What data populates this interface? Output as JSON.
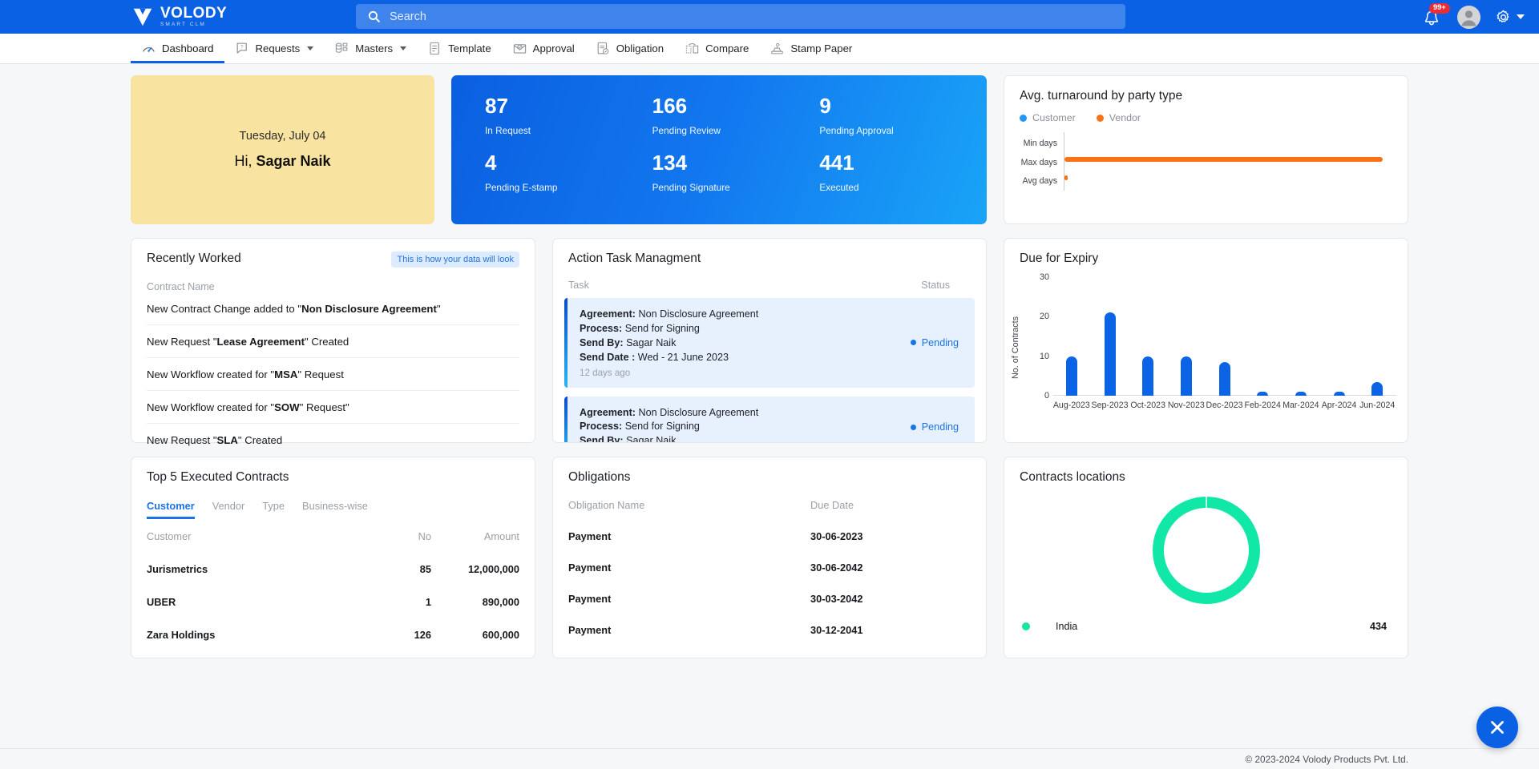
{
  "header": {
    "logo_text": "VOLODY",
    "logo_sub": "SMART CLM",
    "search_placeholder": "Search",
    "search_value": "",
    "notification_badge": "99+"
  },
  "nav": {
    "items": [
      {
        "label": "Dashboard",
        "icon": "speedometer-icon",
        "active": true,
        "caret": false
      },
      {
        "label": "Requests",
        "icon": "request-icon",
        "active": false,
        "caret": true
      },
      {
        "label": "Masters",
        "icon": "masters-icon",
        "active": false,
        "caret": true
      },
      {
        "label": "Template",
        "icon": "template-icon",
        "active": false,
        "caret": false
      },
      {
        "label": "Approval",
        "icon": "approval-icon",
        "active": false,
        "caret": false
      },
      {
        "label": "Obligation",
        "icon": "obligation-icon",
        "active": false,
        "caret": false
      },
      {
        "label": "Compare",
        "icon": "compare-icon",
        "active": false,
        "caret": false
      },
      {
        "label": "Stamp Paper",
        "icon": "stamp-icon",
        "active": false,
        "caret": false
      }
    ]
  },
  "greeting": {
    "date": "Tuesday, July 04",
    "hi_prefix": "Hi, ",
    "user_name": "Sagar Naik"
  },
  "stats": {
    "items": [
      {
        "value": "87",
        "label": "In Request"
      },
      {
        "value": "166",
        "label": "Pending Review"
      },
      {
        "value": "9",
        "label": "Pending Approval"
      },
      {
        "value": "4",
        "label": "Pending E-stamp"
      },
      {
        "value": "134",
        "label": "Pending Signature"
      },
      {
        "value": "441",
        "label": "Executed"
      }
    ]
  },
  "turnaround": {
    "title": "Avg. turnaround by party type",
    "legend": [
      {
        "label": "Customer",
        "color": "#2196f3"
      },
      {
        "label": "Vendor",
        "color": "#f97316"
      }
    ]
  },
  "recently_worked": {
    "title": "Recently Worked",
    "badge": "This is how your data will look",
    "column_header": "Contract Name",
    "items": [
      {
        "prefix": "New Contract Change added to \"",
        "strong": "Non Disclosure Agreement",
        "suffix": "\""
      },
      {
        "prefix": "New Request \"",
        "strong": "Lease Agreement",
        "suffix": "\" Created"
      },
      {
        "prefix": "New Workflow created for \"",
        "strong": "MSA",
        "suffix": "\" Request"
      },
      {
        "prefix": "New Workflow created for \"",
        "strong": "SOW",
        "suffix": "\" Request\""
      },
      {
        "prefix": "New Request \"",
        "strong": "SLA",
        "suffix": "\" Created"
      }
    ]
  },
  "action_tasks": {
    "title": "Action Task Managment",
    "col_task": "Task",
    "col_status": "Status",
    "items": [
      {
        "agreement_label": "Agreement:",
        "agreement_value": "Non Disclosure Agreement",
        "process_label": "Process:",
        "process_value": "Send for Signing",
        "sendby_label": "Send By:",
        "sendby_value": "Sagar Naik",
        "senddate_label": "Send Date :",
        "senddate_value": "Wed - 21 June 2023",
        "ago": "12 days ago",
        "status": "Pending"
      },
      {
        "agreement_label": "Agreement:",
        "agreement_value": "Non Disclosure Agreement",
        "process_label": "Process:",
        "process_value": "Send for Signing",
        "sendby_label": "Send By:",
        "sendby_value": "Sagar Naik",
        "senddate_label": "",
        "senddate_value": "",
        "ago": "",
        "status": "Pending"
      }
    ]
  },
  "due_expiry": {
    "title": "Due for Expiry"
  },
  "top5": {
    "title": "Top 5 Executed Contracts",
    "tabs": [
      {
        "label": "Customer",
        "active": true
      },
      {
        "label": "Vendor",
        "active": false
      },
      {
        "label": "Type",
        "active": false
      },
      {
        "label": "Business-wise",
        "active": false
      }
    ],
    "columns": [
      "Customer",
      "No",
      "Amount"
    ],
    "rows": [
      {
        "name": "Jurismetrics",
        "no": "85",
        "amount": "12,000,000"
      },
      {
        "name": "UBER",
        "no": "1",
        "amount": "890,000"
      },
      {
        "name": "Zara Holdings",
        "no": "126",
        "amount": "600,000"
      }
    ]
  },
  "obligations": {
    "title": "Obligations",
    "columns": [
      "Obligation Name",
      "Due Date"
    ],
    "rows": [
      {
        "name": "Payment",
        "due": "30-06-2023"
      },
      {
        "name": "Payment",
        "due": "30-06-2042"
      },
      {
        "name": "Payment",
        "due": "30-03-2042"
      },
      {
        "name": "Payment",
        "due": "30-12-2041"
      }
    ]
  },
  "locations": {
    "title": "Contracts locations",
    "legend_name": "India",
    "legend_value": "434"
  },
  "footer": {
    "copyright": "© 2023-2024 Volody Products Pvt. Ltd."
  },
  "colors": {
    "brand_blue": "#0b61e4",
    "accent_orange": "#f97316",
    "accent_green": "#11e7a6",
    "status_blue": "#1a73e8",
    "greeting_yellow": "#f9e3a0"
  },
  "chart_data": [
    {
      "type": "bar",
      "orientation": "horizontal",
      "title": "Avg. turnaround by party type",
      "categories": [
        "Min days",
        "Max days",
        "Avg days"
      ],
      "series": [
        {
          "name": "Customer",
          "color": "#2196f3",
          "values": [
            0,
            0,
            0
          ]
        },
        {
          "name": "Vendor",
          "color": "#f97316",
          "values": [
            0,
            100,
            1
          ]
        }
      ],
      "xlabel": "",
      "ylabel": "",
      "xlim": [
        0,
        100
      ],
      "grid": false,
      "legend_position": "top-left"
    },
    {
      "type": "bar",
      "title": "Due for Expiry",
      "categories": [
        "Aug-2023",
        "Sep-2023",
        "Oct-2023",
        "Nov-2023",
        "Dec-2023",
        "Feb-2024",
        "Mar-2024",
        "Apr-2024",
        "Jun-2024"
      ],
      "values": [
        10,
        21,
        10,
        10,
        8.5,
        1,
        1,
        1,
        3.5
      ],
      "color": "#0b63e5",
      "xlabel": "",
      "ylabel": "No. of Contracts",
      "ylim": [
        0,
        30
      ],
      "yticks": [
        0,
        10,
        20,
        30
      ],
      "grid": false
    },
    {
      "type": "pie",
      "variant": "donut",
      "title": "Contracts locations",
      "labels": [
        "India"
      ],
      "values": [
        434
      ],
      "colors": [
        "#11e7a6"
      ],
      "legend_position": "bottom"
    }
  ]
}
